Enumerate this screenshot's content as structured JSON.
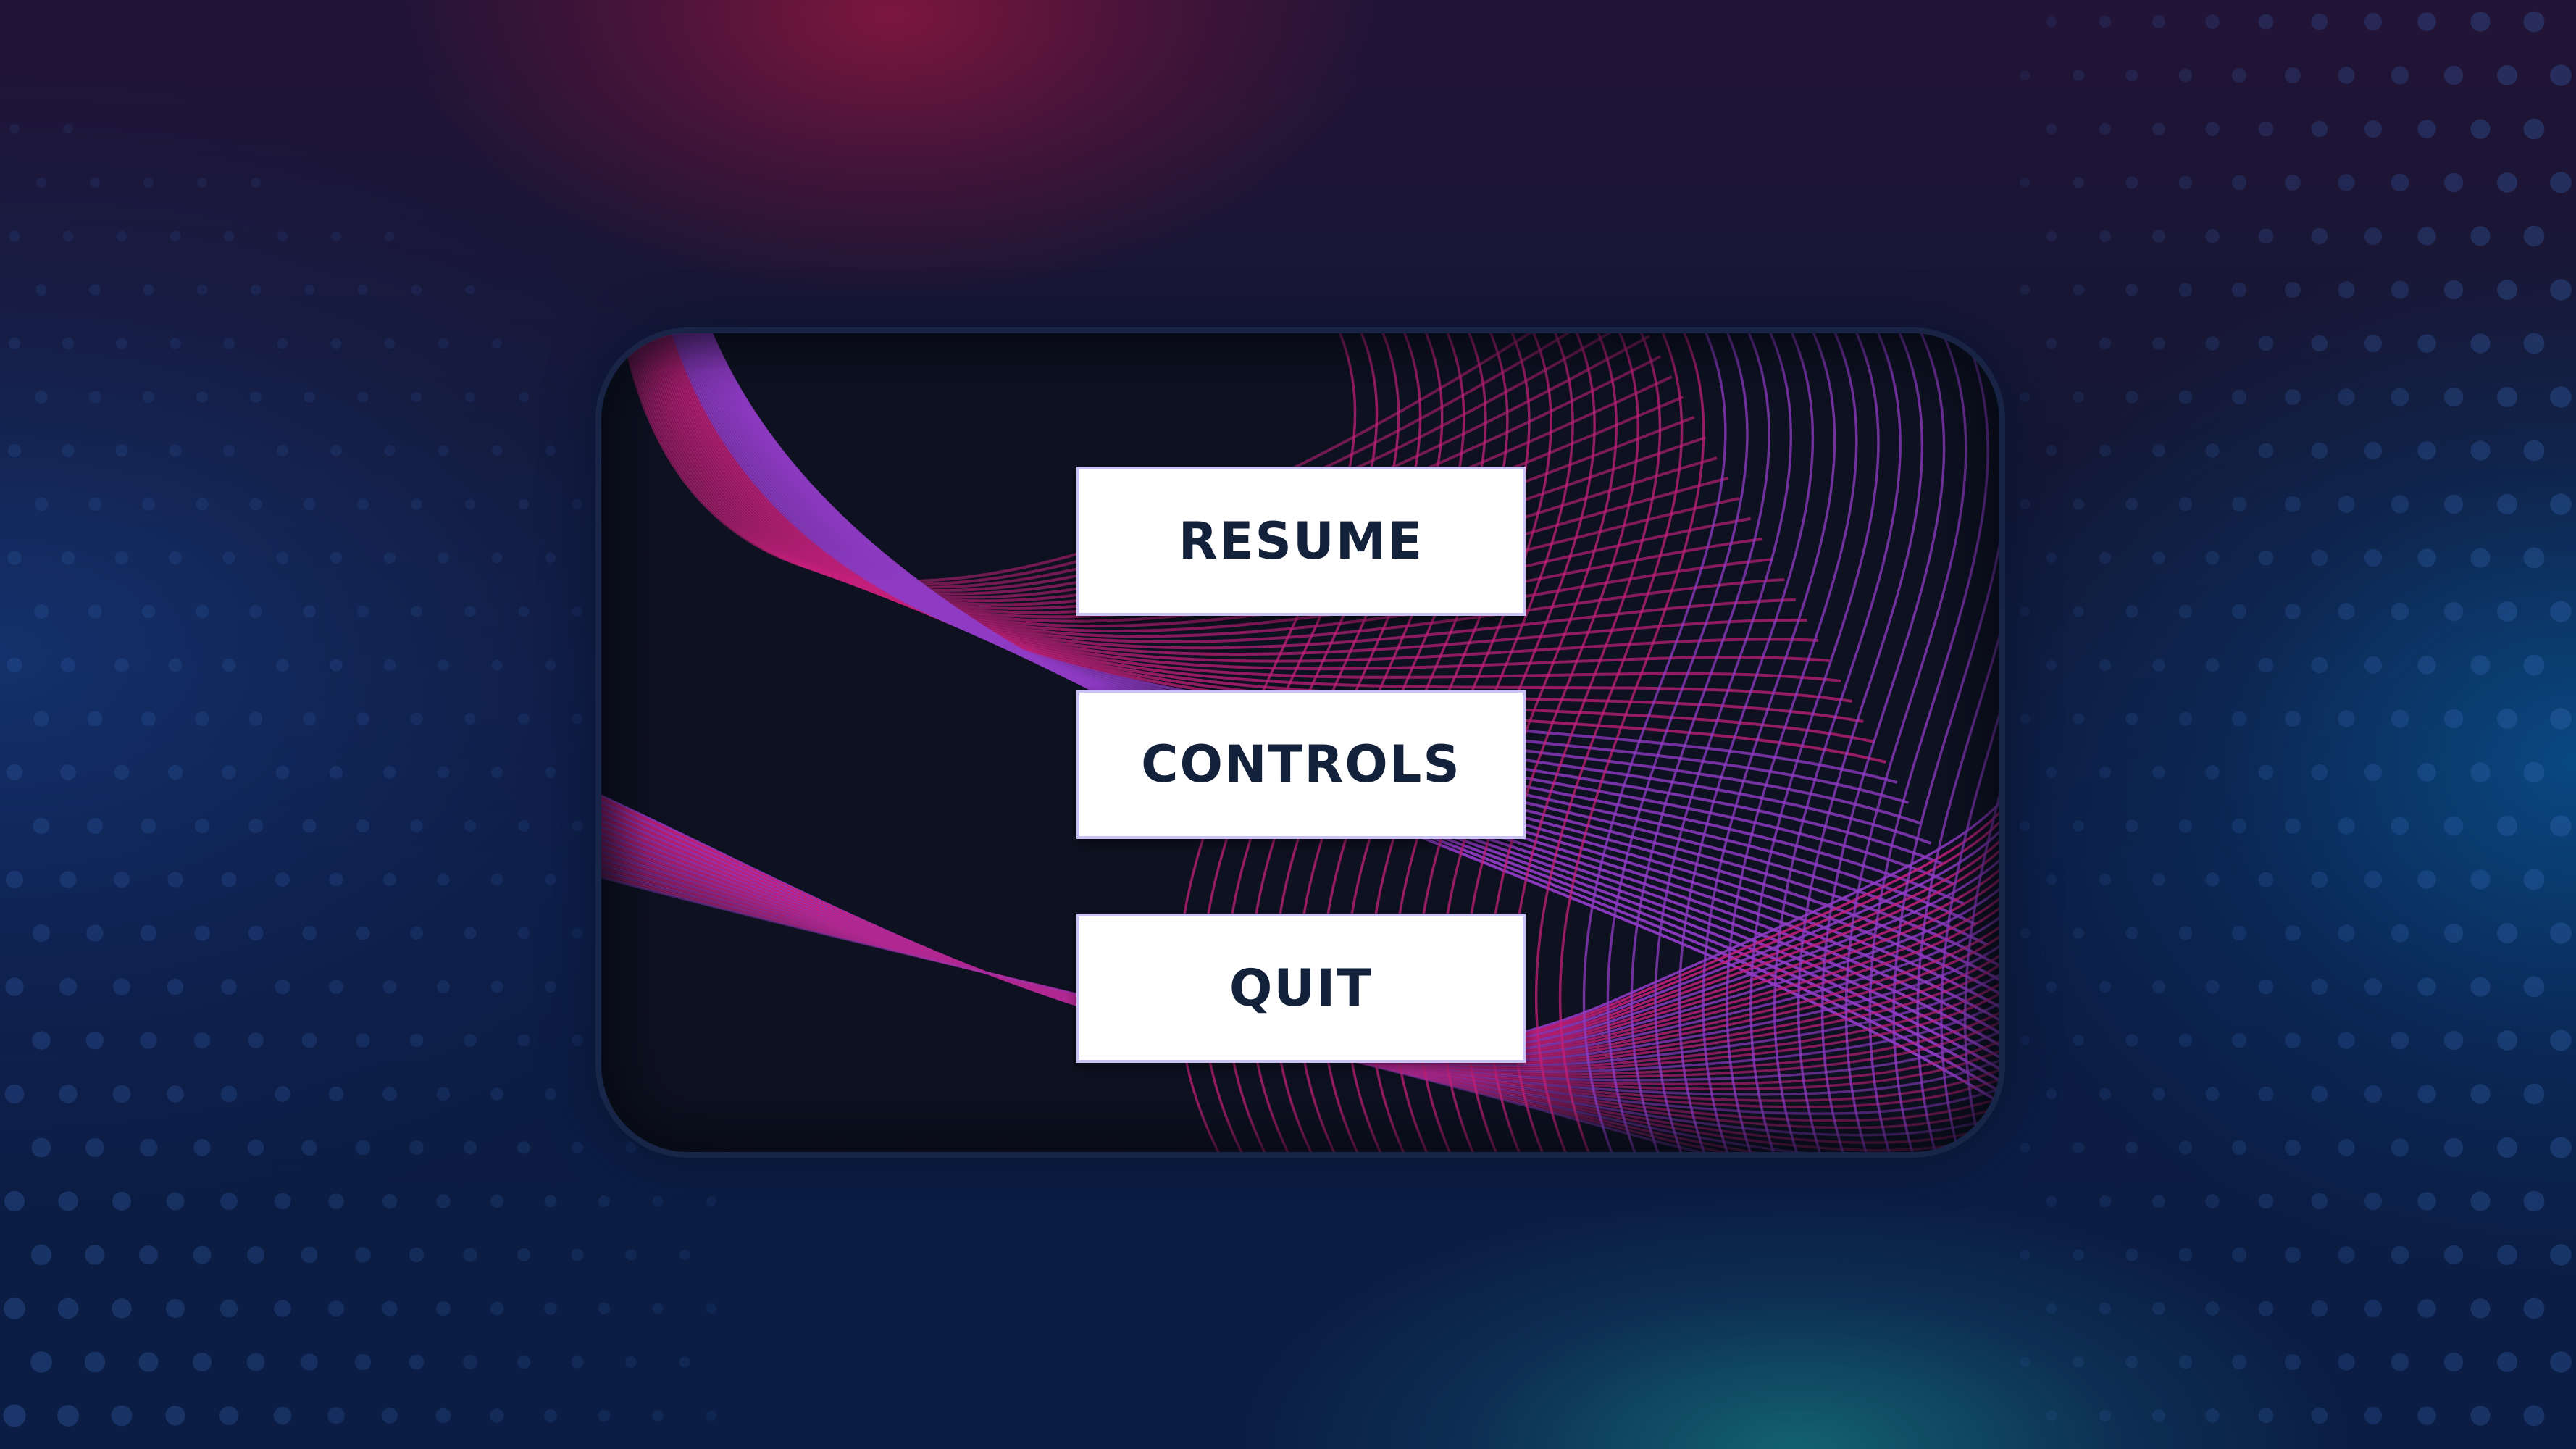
{
  "pause_menu": {
    "resume_label": "RESUME",
    "controls_label": "CONTROLS",
    "quit_label": "QUIT"
  },
  "colors": {
    "line_magenta": "#c2207a",
    "line_violet": "#8f3bc4",
    "button_text": "#13213a",
    "button_bg": "#ffffff"
  },
  "icons": []
}
